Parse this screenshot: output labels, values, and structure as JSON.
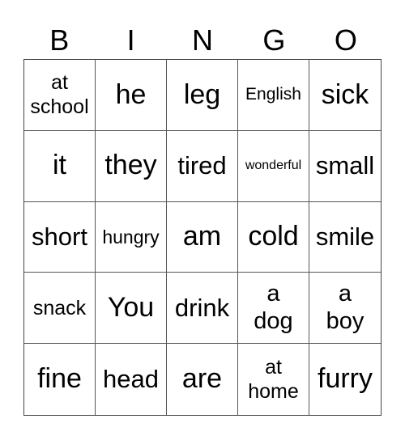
{
  "title_letters": [
    "B",
    "I",
    "N",
    "G",
    "O"
  ],
  "cells": [
    [
      "at\nschool",
      "he",
      "leg",
      "English",
      "sick"
    ],
    [
      "it",
      "they",
      "tired",
      "wonderful",
      "small"
    ],
    [
      "short",
      "hungry",
      "am",
      "cold",
      "smile"
    ],
    [
      "snack",
      "You",
      "drink",
      "a\ndog",
      "a\nboy"
    ],
    [
      "fine",
      "head",
      "are",
      "at\nhome",
      "furry"
    ]
  ]
}
